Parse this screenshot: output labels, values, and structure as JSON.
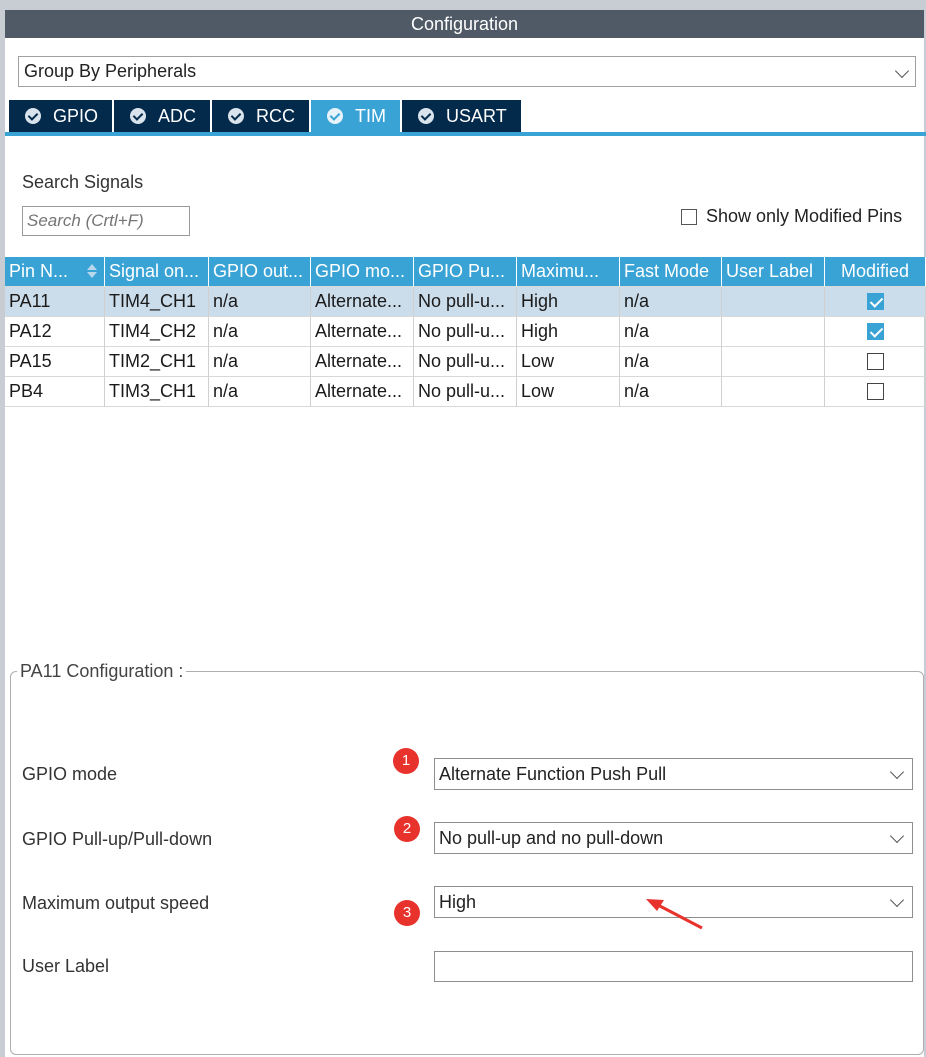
{
  "window": {
    "title": "Configuration"
  },
  "group_by": {
    "value": "Group By Peripherals"
  },
  "tabs": [
    {
      "label": "GPIO",
      "active": false
    },
    {
      "label": "ADC",
      "active": false
    },
    {
      "label": "RCC",
      "active": false
    },
    {
      "label": "TIM",
      "active": true
    },
    {
      "label": "USART",
      "active": false
    }
  ],
  "search": {
    "label": "Search Signals",
    "placeholder": "Search (Crtl+F)",
    "show_modified_label": "Show only Modified Pins"
  },
  "table": {
    "headers": [
      "Pin N...",
      "Signal on...",
      "GPIO out...",
      "GPIO mo...",
      "GPIO Pu...",
      "Maximu...",
      "Fast Mode",
      "User Label",
      "Modified"
    ],
    "rows": [
      {
        "pin": "PA11",
        "signal": "TIM4_CH1",
        "output": "n/a",
        "mode": "Alternate...",
        "pull": "No pull-u...",
        "speed": "High",
        "fast": "n/a",
        "label": "",
        "modified": true
      },
      {
        "pin": "PA12",
        "signal": "TIM4_CH2",
        "output": "n/a",
        "mode": "Alternate...",
        "pull": "No pull-u...",
        "speed": "High",
        "fast": "n/a",
        "label": "",
        "modified": true
      },
      {
        "pin": "PA15",
        "signal": "TIM2_CH1",
        "output": "n/a",
        "mode": "Alternate...",
        "pull": "No pull-u...",
        "speed": "Low",
        "fast": "n/a",
        "label": "",
        "modified": false
      },
      {
        "pin": "PB4",
        "signal": "TIM3_CH1",
        "output": "n/a",
        "mode": "Alternate...",
        "pull": "No pull-u...",
        "speed": "Low",
        "fast": "n/a",
        "label": "",
        "modified": false
      }
    ]
  },
  "config": {
    "legend": "PA11 Configuration :",
    "gpio_mode": {
      "label": "GPIO mode",
      "value": "Alternate Function Push Pull",
      "badge": "1"
    },
    "pull": {
      "label": "GPIO Pull-up/Pull-down",
      "value": "No pull-up and no pull-down",
      "badge": "2"
    },
    "speed": {
      "label": "Maximum output speed",
      "value": "High",
      "badge": "3"
    },
    "user_label": {
      "label": "User Label",
      "value": ""
    }
  },
  "colors": {
    "tab_bg": "#03294b",
    "accent": "#3aa3d6",
    "badge": "#e8322c"
  },
  "icons": [
    "check-circle-icon",
    "chevron-down-icon",
    "sort-icon",
    "checkbox-icon",
    "annotation-arrow-icon"
  ]
}
